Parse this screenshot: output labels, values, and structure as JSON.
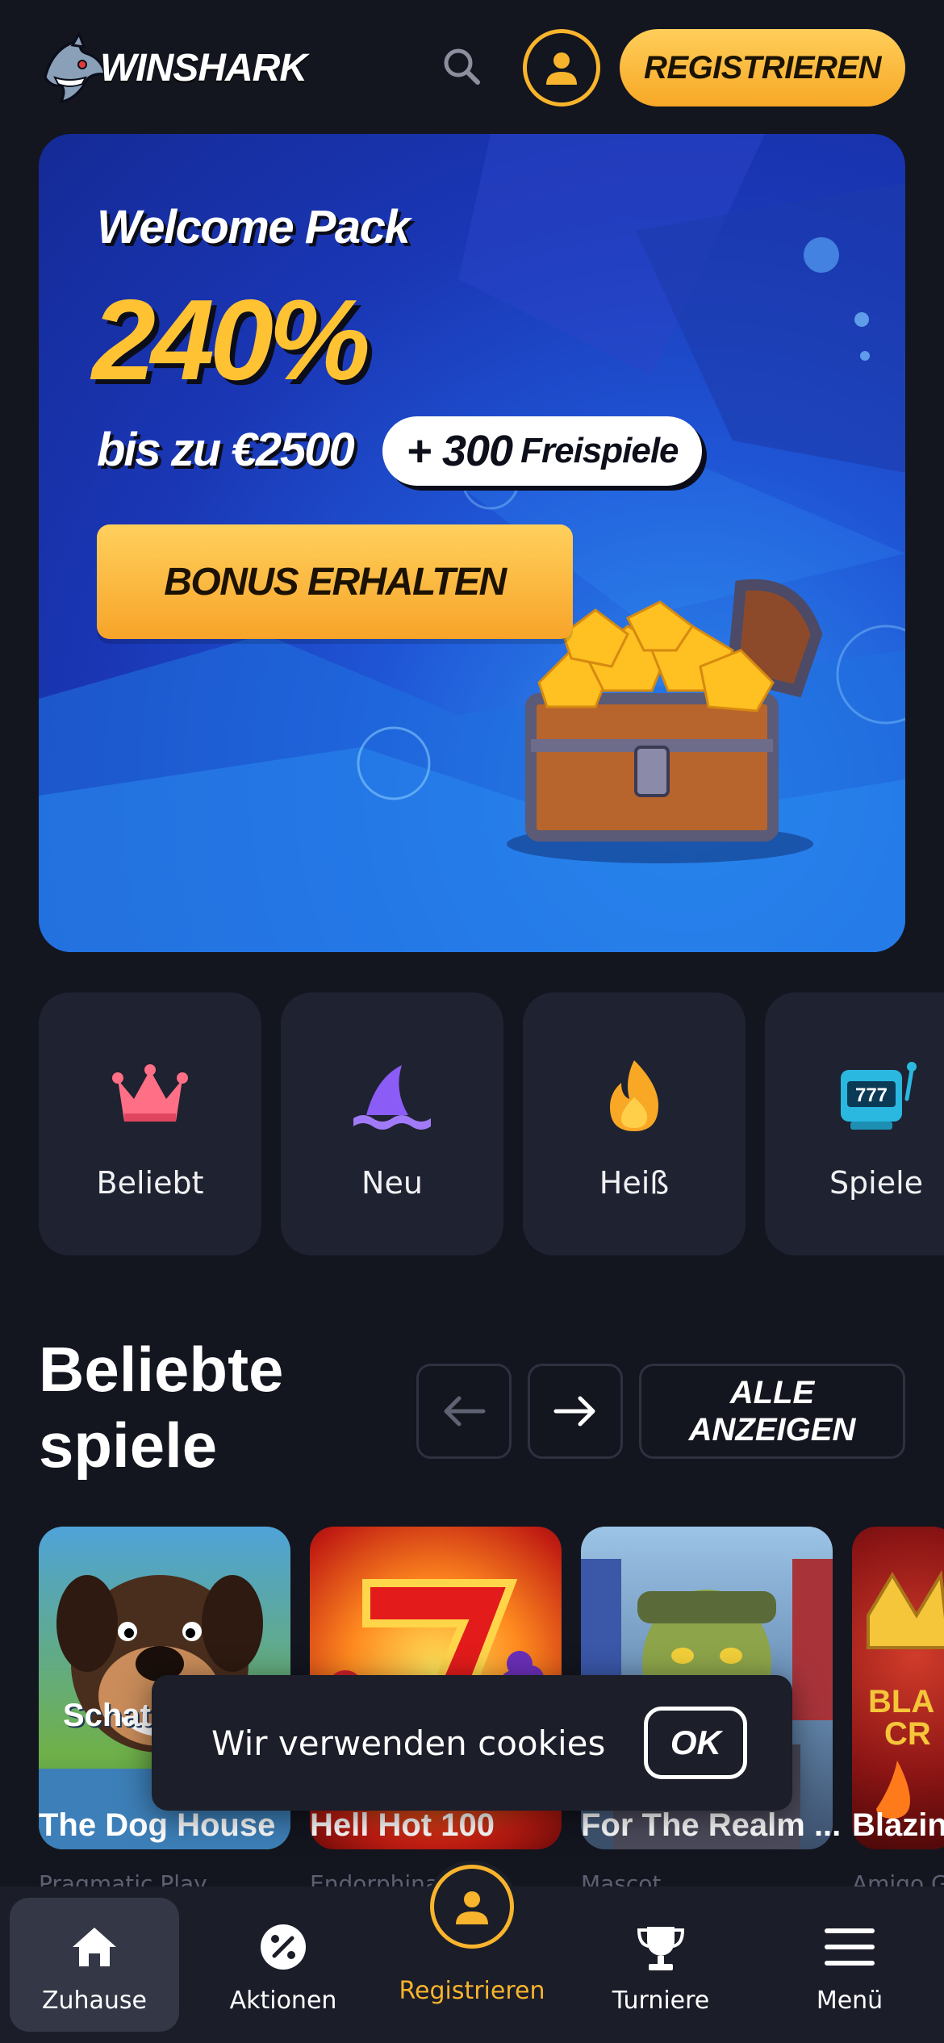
{
  "header": {
    "brand": "WINSHARK",
    "register_label": "REGISTRIEREN"
  },
  "banner": {
    "title": "Welcome Pack",
    "percent": "240%",
    "upto": "bis zu €2500",
    "spins_count": "+ 300",
    "spins_label": "Freispiele",
    "cta_label": "BONUS ERHALTEN"
  },
  "categories": [
    {
      "label": "Beliebt",
      "icon": "crown-icon"
    },
    {
      "label": "Neu",
      "icon": "shark-fin-icon"
    },
    {
      "label": "Heiß",
      "icon": "flame-icon"
    },
    {
      "label": "Spiele",
      "icon": "slot-machine-icon"
    }
  ],
  "popular": {
    "title": "Beliebte spiele",
    "all_label": "ALLE\nANZEIGEN",
    "games": [
      {
        "name": "The Dog House",
        "provider": "Pragmatic Play",
        "overlay": "Schat"
      },
      {
        "name": "Hell Hot 100",
        "provider": "Endorphina"
      },
      {
        "name": "For The Realm ...",
        "provider": "Mascot"
      },
      {
        "name": "Blazin",
        "provider": "Amigo G"
      }
    ]
  },
  "cookie": {
    "text": "Wir verwenden cookies",
    "ok_label": "OK"
  },
  "nav": {
    "items": [
      {
        "label": "Zuhause",
        "icon": "home-icon"
      },
      {
        "label": "Aktionen",
        "icon": "percent-icon"
      },
      {
        "label": "Registrieren",
        "icon": "user-icon"
      },
      {
        "label": "Turniere",
        "icon": "trophy-icon"
      },
      {
        "label": "Menü",
        "icon": "menu-icon"
      }
    ]
  },
  "colors": {
    "background": "#13151f",
    "accent": "#f8b42c",
    "card": "#1f2230",
    "banner_blue": "#1f56d6"
  }
}
